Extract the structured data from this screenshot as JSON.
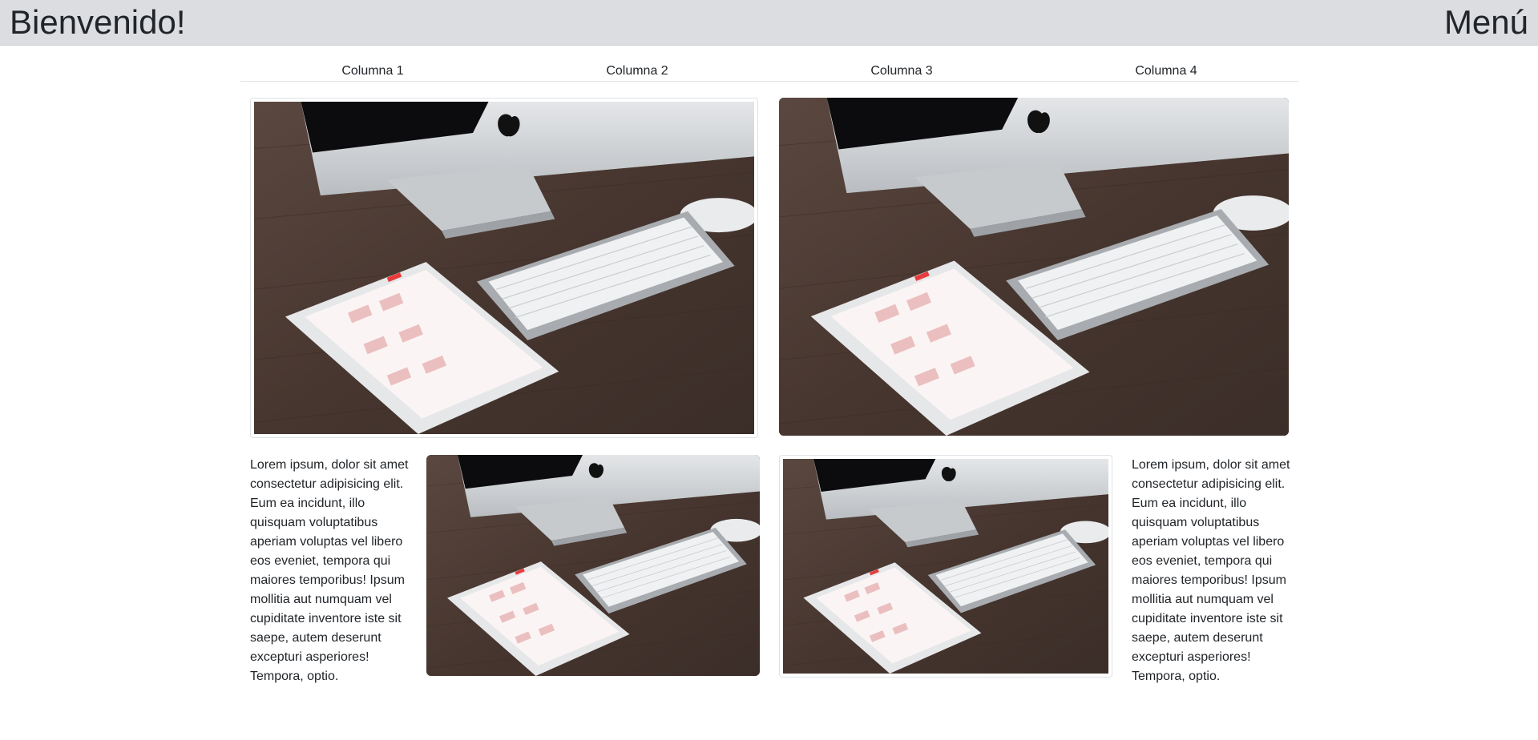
{
  "navbar": {
    "brand": "Bienvenido!",
    "menu": "Menú"
  },
  "tabs": [
    {
      "label": "Columna 1"
    },
    {
      "label": "Columna 2"
    },
    {
      "label": "Columna 3"
    },
    {
      "label": "Columna 4"
    }
  ],
  "content": {
    "paragraph_left": "Lorem ipsum, dolor sit amet consectetur adipisicing elit. Eum ea incidunt, illo quisquam voluptatibus aperiam voluptas vel libero eos eveniet, tempora qui maiores temporibus! Ipsum mollitia aut numquam vel cupiditate inventore iste sit saepe, autem deserunt excepturi asperiores! Tempora, optio.",
    "paragraph_right": "Lorem ipsum, dolor sit amet consectetur adipisicing elit. Eum ea incidunt, illo quisquam voluptatibus aperiam voluptas vel libero eos eveniet, tempora qui maiores temporibus! Ipsum mollitia aut numquam vel cupiditate inventore iste sit saepe, autem deserunt excepturi asperiores! Tempora, optio."
  },
  "images": [
    {
      "subject": "desk-photo-imac-keyboard-ipad",
      "style": "thumbnail"
    },
    {
      "subject": "desk-photo-imac-keyboard-ipad",
      "style": "rounded"
    },
    {
      "subject": "desk-photo-imac-keyboard-ipad",
      "style": "rounded"
    },
    {
      "subject": "desk-photo-imac-keyboard-ipad",
      "style": "thumbnail"
    }
  ],
  "colors": {
    "navbar_bg": "#dcdde0",
    "wood": "#4b3a33",
    "text": "#212529"
  }
}
